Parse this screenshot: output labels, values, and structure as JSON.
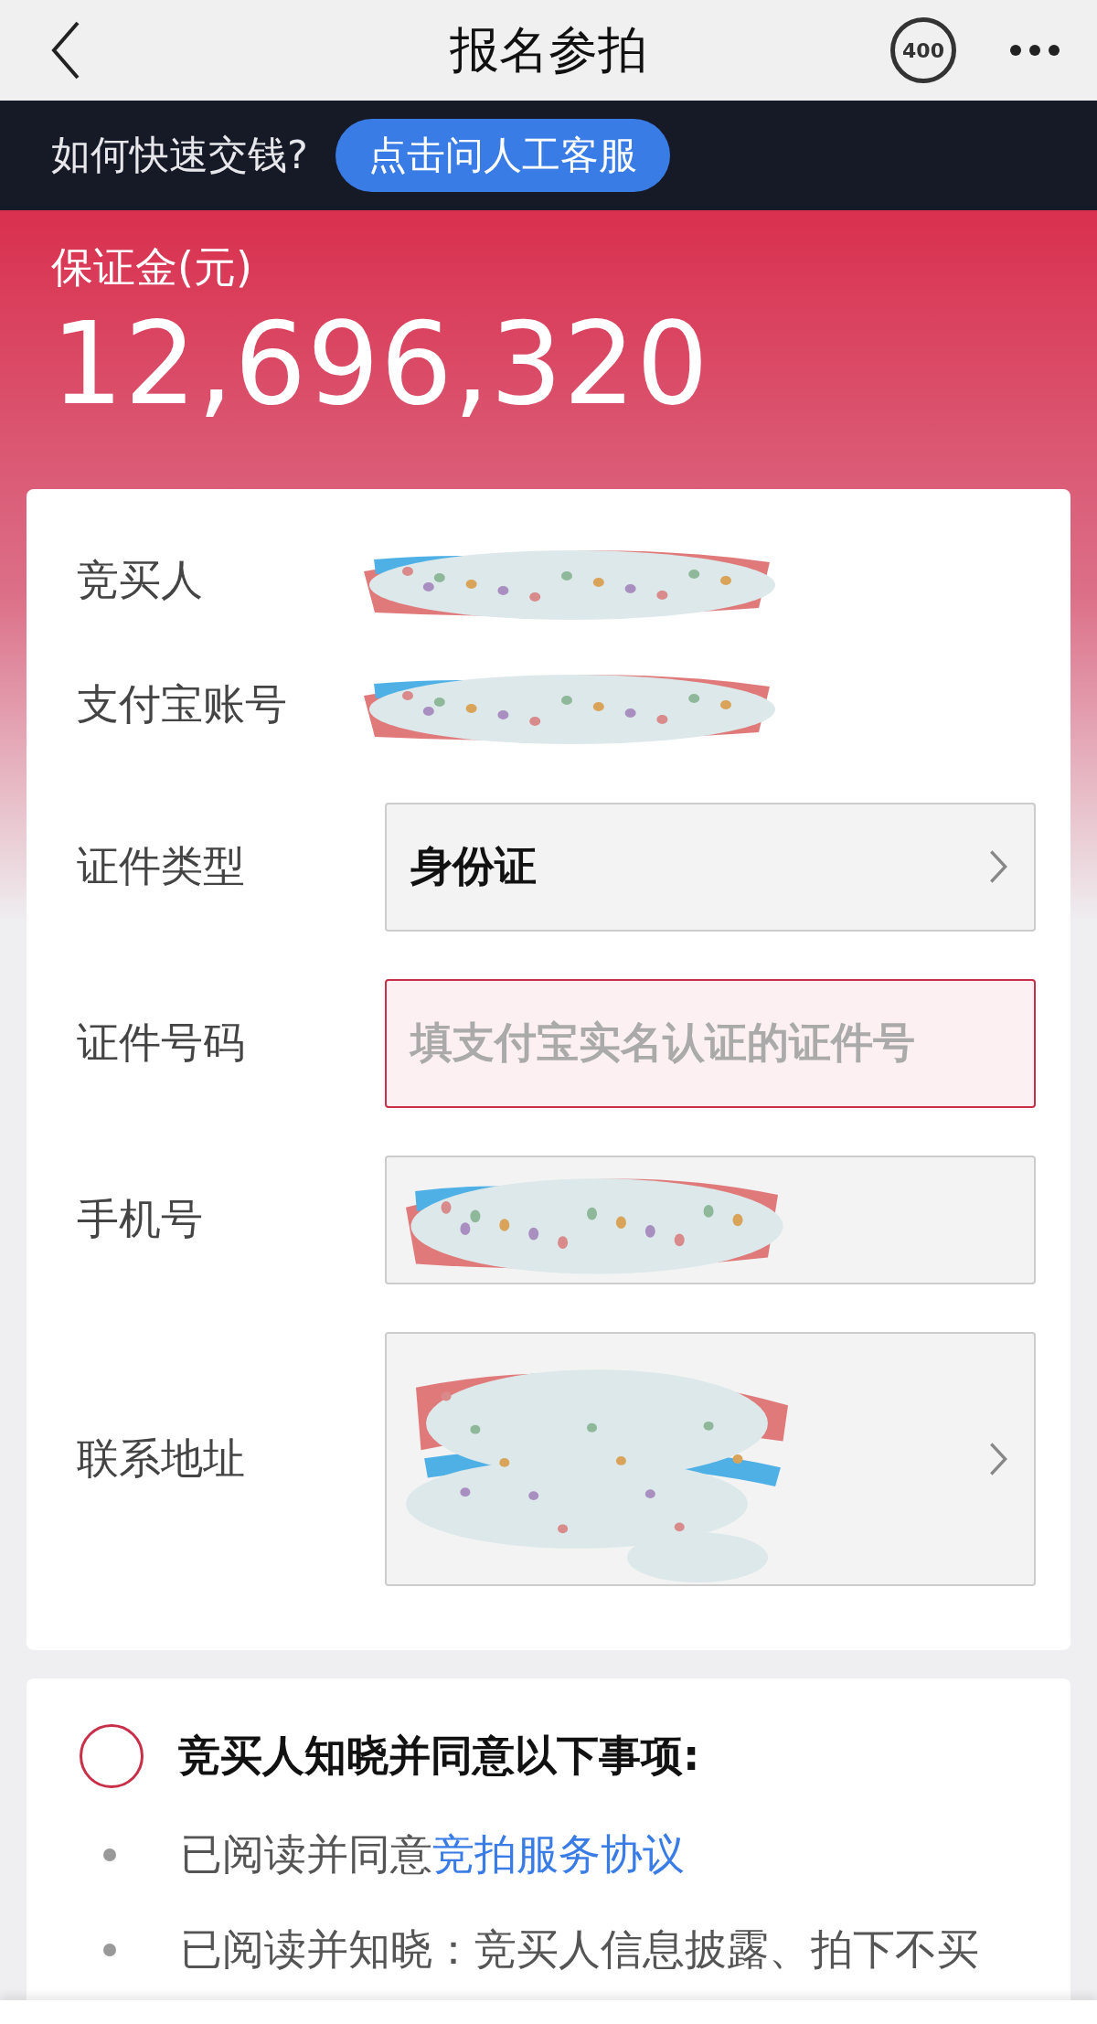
{
  "nav": {
    "title": "报名参拍",
    "hotline": "400"
  },
  "banner": {
    "question": "如何快速交钱?",
    "button": "点击问人工客服"
  },
  "deposit": {
    "label": "保证金(元)",
    "amount": "12,696,320"
  },
  "form": {
    "rows": [
      {
        "label": "竞买人",
        "kind": "plain",
        "redacted": true
      },
      {
        "label": "支付宝账号",
        "kind": "plain",
        "redacted": true
      },
      {
        "label": "证件类型",
        "kind": "select",
        "value": "身份证",
        "redacted": false
      },
      {
        "label": "证件号码",
        "kind": "input",
        "placeholder": "填支付宝实名认证的证件号",
        "invalid": true,
        "redacted": false
      },
      {
        "label": "手机号",
        "kind": "input",
        "invalid": false,
        "redacted": true
      },
      {
        "label": "联系地址",
        "kind": "address",
        "redacted": true
      }
    ]
  },
  "agreement": {
    "checked": false,
    "heading": "竞买人知晓并同意以下事项:",
    "items": [
      {
        "text": "已阅读并同意",
        "link": "竞拍服务协议"
      },
      {
        "text": "已阅读并知晓：竞买人信息披露、拍下不买"
      }
    ]
  }
}
